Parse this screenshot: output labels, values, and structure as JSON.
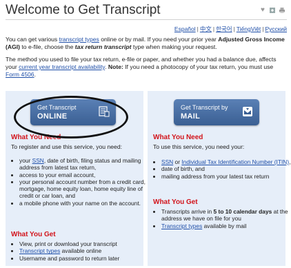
{
  "header": {
    "title": "Welcome to Get Transcript",
    "icons": [
      "heart-icon",
      "share-icon",
      "print-icon"
    ]
  },
  "languages": [
    "Español",
    "中文",
    "한국어",
    "TiếngViệt",
    "Русский"
  ],
  "intro": {
    "p1_a": "You can get various ",
    "p1_link": "transcript types",
    "p1_b": " online or by mail. If you need your prior year ",
    "p1_bold": "Adjusted Gross Income (AGI)",
    "p1_c": " to e-file, choose the ",
    "p1_italic": "tax return transcript",
    "p1_d": " type when making your request.",
    "p2_a": "The method you used to file your tax return, e-file or paper, and whether you had a balance due, affects your ",
    "p2_link": "current year transcript availability",
    "p2_b": ". ",
    "p2_bold": "Note:",
    "p2_c": " If you need a photocopy of your tax return, you must use ",
    "p2_link2": "Form 4506",
    "p2_d": "."
  },
  "online": {
    "button_line1": "Get Transcript",
    "button_line2": "ONLINE",
    "need_heading": "What You Need",
    "need_intro": "To register and use this service, you need:",
    "need_items": [
      {
        "pre": "your ",
        "link": "SSN",
        "post": ", date of birth, filing status and mailing address from latest tax return,"
      },
      {
        "pre": "access to your email account,",
        "link": "",
        "post": ""
      },
      {
        "pre": "your personal account number from a credit card, mortgage, home equity loan, home equity line of credit or car loan, and",
        "link": "",
        "post": ""
      },
      {
        "pre": "a mobile phone with your name on the account.",
        "link": "",
        "post": ""
      }
    ],
    "get_heading": "What You Get",
    "get_items": [
      {
        "pre": "View, print or download your transcript",
        "link": "",
        "post": ""
      },
      {
        "pre": "",
        "link": "Transcript types",
        "post": " available online"
      },
      {
        "pre": "Username and password to return later",
        "link": "",
        "post": ""
      }
    ]
  },
  "mail": {
    "button_line1": "Get Transcript by",
    "button_line2": "MAIL",
    "need_heading": "What You Need",
    "need_intro": "To use this service, you need your:",
    "need_items": [
      {
        "link1": "SSN",
        "mid": " or ",
        "link2": "Individual Tax Identification Number (ITIN)",
        "post": ","
      },
      {
        "text": "date of birth, and"
      },
      {
        "text": "mailing address from your latest tax return"
      }
    ],
    "get_heading": "What You Get",
    "get_items": [
      {
        "pre": "Transcripts arrive in ",
        "bold": "5 to 10 calendar days",
        "post": " at the address we have on file for you"
      },
      {
        "link": "Transcript types",
        "post": " available by mail"
      }
    ]
  },
  "colors": {
    "panel_bg": "#e6eef9",
    "button": "#4a6fa5",
    "heading_red": "#d2141b",
    "link": "#1f4fa8"
  }
}
